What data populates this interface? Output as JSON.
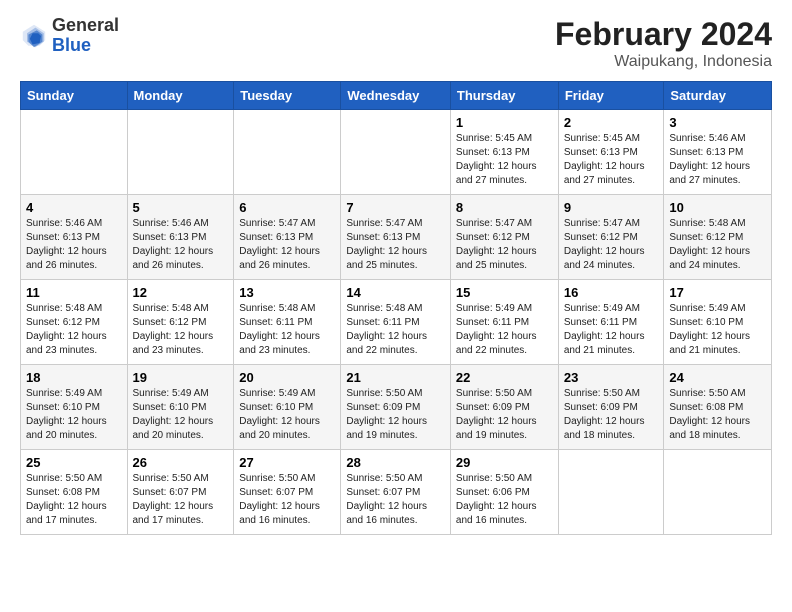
{
  "header": {
    "logo": {
      "general": "General",
      "blue": "Blue"
    },
    "month": "February 2024",
    "location": "Waipukang, Indonesia"
  },
  "weekdays": [
    "Sunday",
    "Monday",
    "Tuesday",
    "Wednesday",
    "Thursday",
    "Friday",
    "Saturday"
  ],
  "weeks": [
    [
      {
        "day": "",
        "sunrise": "",
        "sunset": "",
        "daylight": ""
      },
      {
        "day": "",
        "sunrise": "",
        "sunset": "",
        "daylight": ""
      },
      {
        "day": "",
        "sunrise": "",
        "sunset": "",
        "daylight": ""
      },
      {
        "day": "",
        "sunrise": "",
        "sunset": "",
        "daylight": ""
      },
      {
        "day": "1",
        "sunrise": "Sunrise: 5:45 AM",
        "sunset": "Sunset: 6:13 PM",
        "daylight": "Daylight: 12 hours and 27 minutes."
      },
      {
        "day": "2",
        "sunrise": "Sunrise: 5:45 AM",
        "sunset": "Sunset: 6:13 PM",
        "daylight": "Daylight: 12 hours and 27 minutes."
      },
      {
        "day": "3",
        "sunrise": "Sunrise: 5:46 AM",
        "sunset": "Sunset: 6:13 PM",
        "daylight": "Daylight: 12 hours and 27 minutes."
      }
    ],
    [
      {
        "day": "4",
        "sunrise": "Sunrise: 5:46 AM",
        "sunset": "Sunset: 6:13 PM",
        "daylight": "Daylight: 12 hours and 26 minutes."
      },
      {
        "day": "5",
        "sunrise": "Sunrise: 5:46 AM",
        "sunset": "Sunset: 6:13 PM",
        "daylight": "Daylight: 12 hours and 26 minutes."
      },
      {
        "day": "6",
        "sunrise": "Sunrise: 5:47 AM",
        "sunset": "Sunset: 6:13 PM",
        "daylight": "Daylight: 12 hours and 26 minutes."
      },
      {
        "day": "7",
        "sunrise": "Sunrise: 5:47 AM",
        "sunset": "Sunset: 6:13 PM",
        "daylight": "Daylight: 12 hours and 25 minutes."
      },
      {
        "day": "8",
        "sunrise": "Sunrise: 5:47 AM",
        "sunset": "Sunset: 6:12 PM",
        "daylight": "Daylight: 12 hours and 25 minutes."
      },
      {
        "day": "9",
        "sunrise": "Sunrise: 5:47 AM",
        "sunset": "Sunset: 6:12 PM",
        "daylight": "Daylight: 12 hours and 24 minutes."
      },
      {
        "day": "10",
        "sunrise": "Sunrise: 5:48 AM",
        "sunset": "Sunset: 6:12 PM",
        "daylight": "Daylight: 12 hours and 24 minutes."
      }
    ],
    [
      {
        "day": "11",
        "sunrise": "Sunrise: 5:48 AM",
        "sunset": "Sunset: 6:12 PM",
        "daylight": "Daylight: 12 hours and 23 minutes."
      },
      {
        "day": "12",
        "sunrise": "Sunrise: 5:48 AM",
        "sunset": "Sunset: 6:12 PM",
        "daylight": "Daylight: 12 hours and 23 minutes."
      },
      {
        "day": "13",
        "sunrise": "Sunrise: 5:48 AM",
        "sunset": "Sunset: 6:11 PM",
        "daylight": "Daylight: 12 hours and 23 minutes."
      },
      {
        "day": "14",
        "sunrise": "Sunrise: 5:48 AM",
        "sunset": "Sunset: 6:11 PM",
        "daylight": "Daylight: 12 hours and 22 minutes."
      },
      {
        "day": "15",
        "sunrise": "Sunrise: 5:49 AM",
        "sunset": "Sunset: 6:11 PM",
        "daylight": "Daylight: 12 hours and 22 minutes."
      },
      {
        "day": "16",
        "sunrise": "Sunrise: 5:49 AM",
        "sunset": "Sunset: 6:11 PM",
        "daylight": "Daylight: 12 hours and 21 minutes."
      },
      {
        "day": "17",
        "sunrise": "Sunrise: 5:49 AM",
        "sunset": "Sunset: 6:10 PM",
        "daylight": "Daylight: 12 hours and 21 minutes."
      }
    ],
    [
      {
        "day": "18",
        "sunrise": "Sunrise: 5:49 AM",
        "sunset": "Sunset: 6:10 PM",
        "daylight": "Daylight: 12 hours and 20 minutes."
      },
      {
        "day": "19",
        "sunrise": "Sunrise: 5:49 AM",
        "sunset": "Sunset: 6:10 PM",
        "daylight": "Daylight: 12 hours and 20 minutes."
      },
      {
        "day": "20",
        "sunrise": "Sunrise: 5:49 AM",
        "sunset": "Sunset: 6:10 PM",
        "daylight": "Daylight: 12 hours and 20 minutes."
      },
      {
        "day": "21",
        "sunrise": "Sunrise: 5:50 AM",
        "sunset": "Sunset: 6:09 PM",
        "daylight": "Daylight: 12 hours and 19 minutes."
      },
      {
        "day": "22",
        "sunrise": "Sunrise: 5:50 AM",
        "sunset": "Sunset: 6:09 PM",
        "daylight": "Daylight: 12 hours and 19 minutes."
      },
      {
        "day": "23",
        "sunrise": "Sunrise: 5:50 AM",
        "sunset": "Sunset: 6:09 PM",
        "daylight": "Daylight: 12 hours and 18 minutes."
      },
      {
        "day": "24",
        "sunrise": "Sunrise: 5:50 AM",
        "sunset": "Sunset: 6:08 PM",
        "daylight": "Daylight: 12 hours and 18 minutes."
      }
    ],
    [
      {
        "day": "25",
        "sunrise": "Sunrise: 5:50 AM",
        "sunset": "Sunset: 6:08 PM",
        "daylight": "Daylight: 12 hours and 17 minutes."
      },
      {
        "day": "26",
        "sunrise": "Sunrise: 5:50 AM",
        "sunset": "Sunset: 6:07 PM",
        "daylight": "Daylight: 12 hours and 17 minutes."
      },
      {
        "day": "27",
        "sunrise": "Sunrise: 5:50 AM",
        "sunset": "Sunset: 6:07 PM",
        "daylight": "Daylight: 12 hours and 16 minutes."
      },
      {
        "day": "28",
        "sunrise": "Sunrise: 5:50 AM",
        "sunset": "Sunset: 6:07 PM",
        "daylight": "Daylight: 12 hours and 16 minutes."
      },
      {
        "day": "29",
        "sunrise": "Sunrise: 5:50 AM",
        "sunset": "Sunset: 6:06 PM",
        "daylight": "Daylight: 12 hours and 16 minutes."
      },
      {
        "day": "",
        "sunrise": "",
        "sunset": "",
        "daylight": ""
      },
      {
        "day": "",
        "sunrise": "",
        "sunset": "",
        "daylight": ""
      }
    ]
  ]
}
